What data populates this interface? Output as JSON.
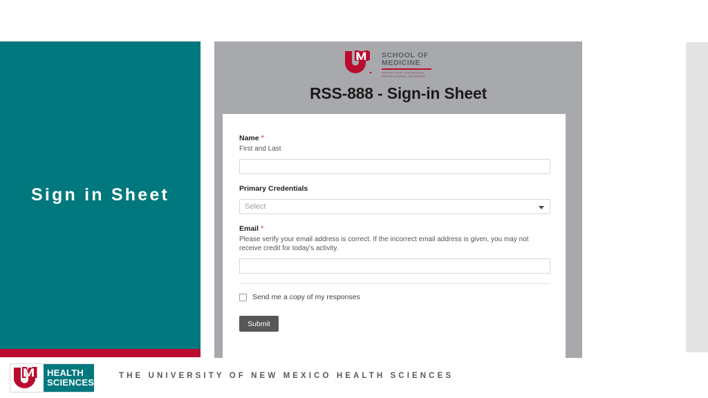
{
  "slide": {
    "background_color": "#ffffff",
    "teal_color": "#00787d",
    "crimson_color": "#ba0c2f",
    "panel_gray": "#a8a9ad",
    "strip_gray": "#e4e4e4"
  },
  "left_panel": {
    "title": "Sign in Sheet"
  },
  "form": {
    "logo": {
      "mark": "unm-lobo-logo",
      "line1": "SCHOOL OF",
      "line2": "MEDICINE",
      "sub_line1": "OFFICE FOR CONTINUOUS",
      "sub_line2": "PROFESSIONAL LEARNING"
    },
    "title": "RSS-888 - Sign-in Sheet",
    "fields": [
      {
        "key": "name",
        "label": "Name",
        "required": true,
        "required_marker": "*",
        "help": "First and Last",
        "type": "text",
        "value": "",
        "placeholder": ""
      },
      {
        "key": "primary_credentials",
        "label": "Primary Credentials",
        "required": false,
        "required_marker": "",
        "help": "",
        "type": "select",
        "value": "Select",
        "arrow_icon": "chevron-down-icon"
      },
      {
        "key": "email",
        "label": "Email",
        "required": true,
        "required_marker": "*",
        "help": "Please verify your email address is correct. If the incorrect email address is given, you may not receive credit for today's activity.",
        "type": "text",
        "value": "",
        "placeholder": ""
      }
    ],
    "checkbox": {
      "label": "Send me a copy of my responses",
      "checked": false
    },
    "submit_label": "Submit"
  },
  "footer": {
    "logo": {
      "mark": "unm-lobo-logo",
      "line1": "HEALTH",
      "line2": "SCIENCES"
    },
    "text": "THE UNIVERSITY OF NEW MEXICO HEALTH SCIENCES"
  }
}
